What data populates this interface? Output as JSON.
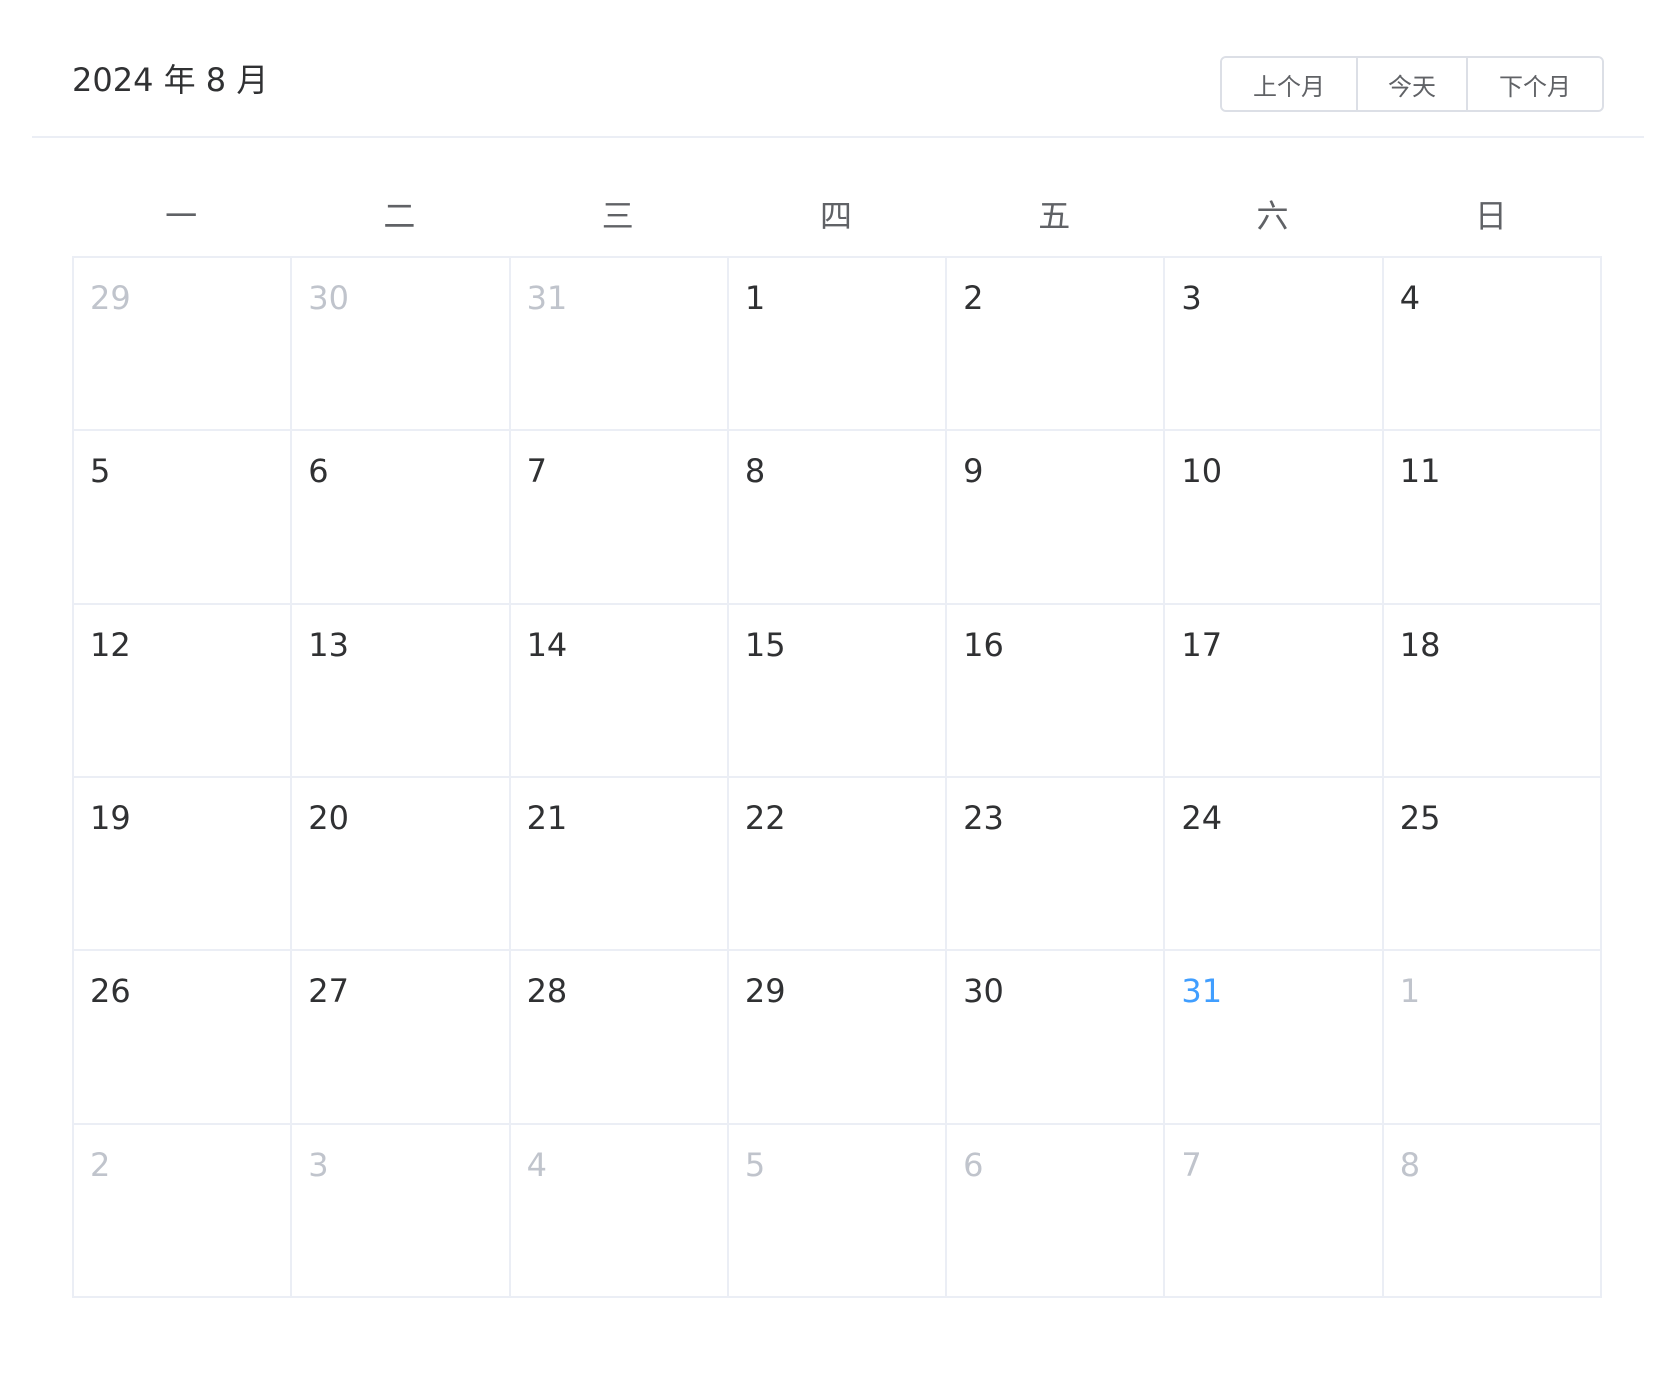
{
  "header": {
    "title": "2024 年 8 月",
    "buttons": {
      "prev": "上个月",
      "today": "今天",
      "next": "下个月"
    }
  },
  "weekdays": [
    "一",
    "二",
    "三",
    "四",
    "五",
    "六",
    "日"
  ],
  "colors": {
    "current_month_text": "#303133",
    "other_month_text": "#c0c4cc",
    "today_text": "#409eff",
    "border": "#ebeef5"
  },
  "days": [
    {
      "num": "29",
      "type": "prev"
    },
    {
      "num": "30",
      "type": "prev"
    },
    {
      "num": "31",
      "type": "prev"
    },
    {
      "num": "1",
      "type": "current"
    },
    {
      "num": "2",
      "type": "current"
    },
    {
      "num": "3",
      "type": "current"
    },
    {
      "num": "4",
      "type": "current"
    },
    {
      "num": "5",
      "type": "current"
    },
    {
      "num": "6",
      "type": "current"
    },
    {
      "num": "7",
      "type": "current"
    },
    {
      "num": "8",
      "type": "current"
    },
    {
      "num": "9",
      "type": "current"
    },
    {
      "num": "10",
      "type": "current"
    },
    {
      "num": "11",
      "type": "current"
    },
    {
      "num": "12",
      "type": "current"
    },
    {
      "num": "13",
      "type": "current"
    },
    {
      "num": "14",
      "type": "current"
    },
    {
      "num": "15",
      "type": "current"
    },
    {
      "num": "16",
      "type": "current"
    },
    {
      "num": "17",
      "type": "current"
    },
    {
      "num": "18",
      "type": "current"
    },
    {
      "num": "19",
      "type": "current"
    },
    {
      "num": "20",
      "type": "current"
    },
    {
      "num": "21",
      "type": "current"
    },
    {
      "num": "22",
      "type": "current"
    },
    {
      "num": "23",
      "type": "current"
    },
    {
      "num": "24",
      "type": "current"
    },
    {
      "num": "25",
      "type": "current"
    },
    {
      "num": "26",
      "type": "current"
    },
    {
      "num": "27",
      "type": "current"
    },
    {
      "num": "28",
      "type": "current"
    },
    {
      "num": "29",
      "type": "current"
    },
    {
      "num": "30",
      "type": "current"
    },
    {
      "num": "31",
      "type": "today"
    },
    {
      "num": "1",
      "type": "next"
    },
    {
      "num": "2",
      "type": "next"
    },
    {
      "num": "3",
      "type": "next"
    },
    {
      "num": "4",
      "type": "next"
    },
    {
      "num": "5",
      "type": "next"
    },
    {
      "num": "6",
      "type": "next"
    },
    {
      "num": "7",
      "type": "next"
    },
    {
      "num": "8",
      "type": "next"
    }
  ]
}
